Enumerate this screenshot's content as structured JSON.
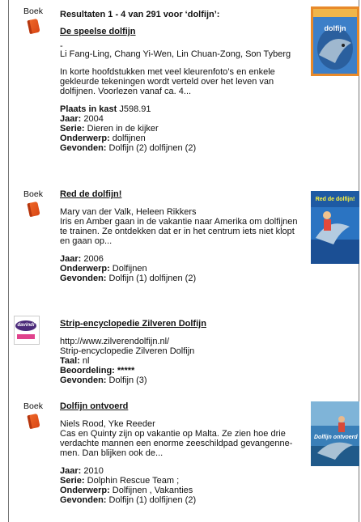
{
  "heading": "Resultaten 1 - 4 van 291 voor ‘dolfijn’:",
  "results": [
    {
      "type_label": "Boek",
      "title": "De speelse dolfijn",
      "dash": "-",
      "authors": "Li Fang-Ling, Chang Yi-Wen, Lin Chuan-Zong, Son Tyberg",
      "description": "In korte hoofdstukken met veel kleurenfoto’s en enkele gekleurde tekeningen wordt verteld over het leven van dolfijnen. Voorlezen vanaf ca. 4...",
      "shelf_label": "Plaats in kast",
      "shelf": "J598.91",
      "year_label": "Jaar:",
      "year": "2004",
      "series_label": "Serie:",
      "series": "Dieren in de kijker",
      "subject_label": "Onderwerp:",
      "subject": "dolfijnen",
      "found_label": "Gevonden:",
      "found": "Dolfijn (2) dolfijnen (2)",
      "cover_text": "dolfijn"
    },
    {
      "type_label": "Boek",
      "title": "Red de dolfijn!",
      "authors": "Mary van der Valk, Heleen Rikkers",
      "description": "Iris en Amber gaan in de vakantie naar Amerika om dolfijnen te trainen. Ze ontdekken dat er in het centrum iets niet klopt en gaan op...",
      "year_label": "Jaar:",
      "year": "2006",
      "subject_label": "Onderwerp:",
      "subject": "Dolfijnen",
      "found_label": "Gevonden:",
      "found": "Dolfijn (1) dolfijnen (2)",
      "cover_text": "Red de dolfijn!"
    },
    {
      "logo_text": "davindi",
      "title": "Strip-encyclopedie Zilveren Dolfijn",
      "url": "http://www.zilverendolfijn.nl/",
      "site_name": "Strip-encyclopedie Zilveren Dolfijn",
      "lang_label": "Taal:",
      "lang": "nl",
      "rating_label": "Beoordeling:",
      "rating": "*****",
      "found_label": "Gevonden:",
      "found": "Dolfijn (3)"
    },
    {
      "type_label": "Boek",
      "title": "Dolfijn ontvoerd",
      "authors": "Niels Rood, Yke Reeder",
      "description": "Cas en Quinty zijn op vakantie op Malta. Ze zien hoe drie verdachte mannen een enorme zeeschildpad gevangenne-men. Dan blijken ook de...",
      "year_label": "Jaar:",
      "year": "2010",
      "series_label": "Serie:",
      "series": "Dolphin Rescue Team ;",
      "subject_label": "Onderwerp:",
      "subject": "Dolfijnen , Vakanties",
      "found_label": "Gevonden:",
      "found": "Dolfijn (1) dolfijnen (2)",
      "cover_text": "Dolfijn ontvoerd"
    }
  ],
  "colors": {
    "book_icon": "#e8561c",
    "logo_purple": "#4b2a7a",
    "logo_pink": "#e0428c"
  }
}
